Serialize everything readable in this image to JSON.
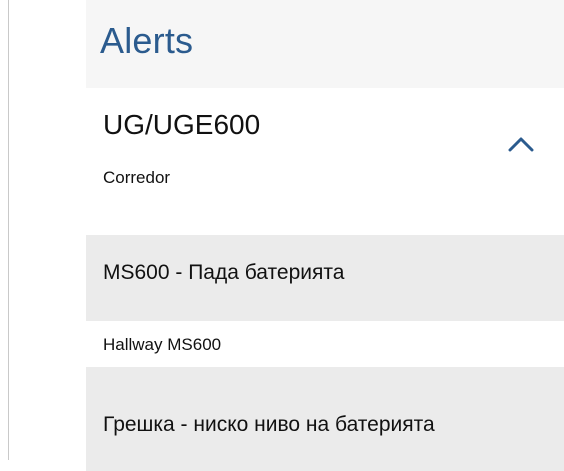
{
  "panel": {
    "title": "Alerts"
  },
  "group": {
    "title": "UG/UGE600",
    "subtitle": "Corredor",
    "toggle_icon": "chevron-up-icon"
  },
  "rows": [
    {
      "label": "MS600 - Пада батерията"
    },
    {
      "label": "Hallway MS600"
    },
    {
      "label": "Грешка - ниско ниво на батерията"
    }
  ],
  "colors": {
    "accent": "#2b5b8e",
    "row_gray": "#ebebeb",
    "header_bg": "#f6f6f6",
    "text": "#111111"
  }
}
